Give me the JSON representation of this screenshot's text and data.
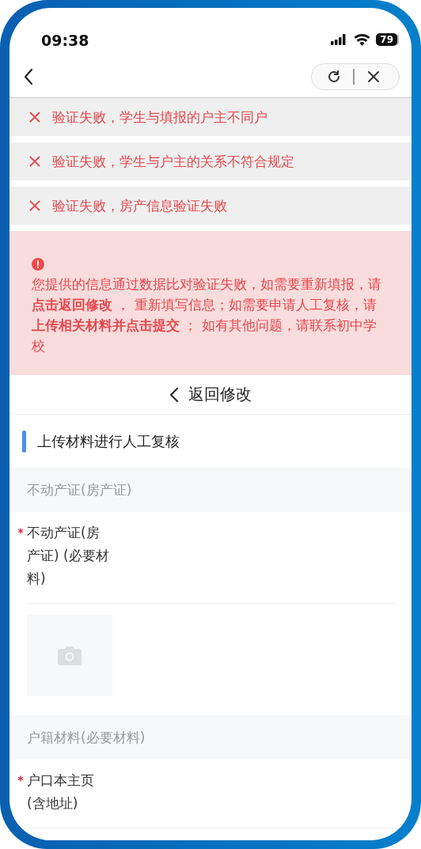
{
  "status_bar": {
    "time": "09:38",
    "battery": "79"
  },
  "errors": [
    {
      "text": "验证失败，学生与填报的户主不同户"
    },
    {
      "text": "验证失败，学生与户主的关系不符合规定"
    },
    {
      "text": "验证失败，房产信息验证失败"
    }
  ],
  "alert": {
    "text": "您提供的信息通过数据比对验证失败，如需要重新填报，请**点击返回修改** ， 重新填写信息；如需要申请人工复核，请**上传相关材料并点击提交** ； 如有其他问题，请联系初中学校"
  },
  "back_button": {
    "label": "返回修改"
  },
  "section_title": "上传材料进行人工复核",
  "groups": [
    {
      "title": "不动产证(房产证)",
      "fields": [
        {
          "label": "不动产证(房产证) (必要材料)",
          "required": true
        }
      ]
    },
    {
      "title": "户籍材料(必要材料)",
      "fields": [
        {
          "label": "户口本主页(含地址)",
          "required": true
        }
      ]
    }
  ]
}
